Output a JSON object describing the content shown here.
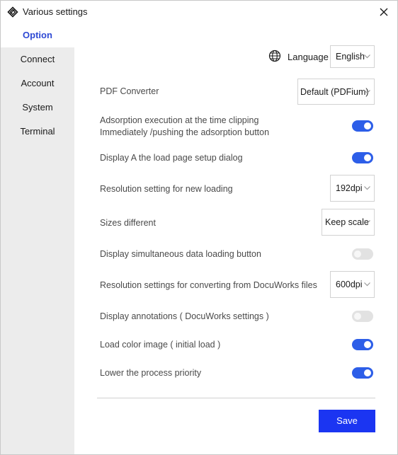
{
  "window": {
    "title": "Various settings"
  },
  "sidebar": {
    "items": [
      {
        "label": "Option",
        "active": true
      },
      {
        "label": "Connect",
        "active": false
      },
      {
        "label": "Account",
        "active": false
      },
      {
        "label": "System",
        "active": false
      },
      {
        "label": "Terminal",
        "active": false
      }
    ]
  },
  "language": {
    "label": "Language",
    "value": "English"
  },
  "settings": {
    "pdf_converter": {
      "label": "PDF Converter",
      "value": "Default (PDFium)"
    },
    "adsorption": {
      "label_line1": "Adsorption execution at the time clipping",
      "label_line2": "Immediately /pushing the adsorption button",
      "on": true
    },
    "load_page_setup": {
      "label": "Display A the load page setup dialog",
      "on": true
    },
    "resolution_new": {
      "label": "Resolution setting for new loading",
      "value": "192dpi"
    },
    "sizes_different": {
      "label": "Sizes different",
      "value": "Keep scale"
    },
    "simultaneous_button": {
      "label": "Display simultaneous data loading button",
      "on": false
    },
    "resolution_docuworks": {
      "label": "Resolution settings for converting from DocuWorks files",
      "value": "600dpi"
    },
    "annotations": {
      "label": "Display annotations ( DocuWorks settings )",
      "on": false
    },
    "load_color": {
      "label": "Load color image ( initial load )",
      "on": true
    },
    "lower_priority": {
      "label": "Lower the process priority",
      "on": true
    }
  },
  "footer": {
    "save_label": "Save"
  },
  "colors": {
    "accent": "#2e49d4",
    "toggle_on": "#2d5ee8",
    "toggle_off": "#e2e2e2",
    "save": "#1b35f2",
    "sidebar_bg": "#ececec"
  },
  "icons": {
    "app": "layers-icon",
    "close": "close-icon",
    "language": "globe-icon",
    "dropdown": "chevron-down-icon"
  }
}
